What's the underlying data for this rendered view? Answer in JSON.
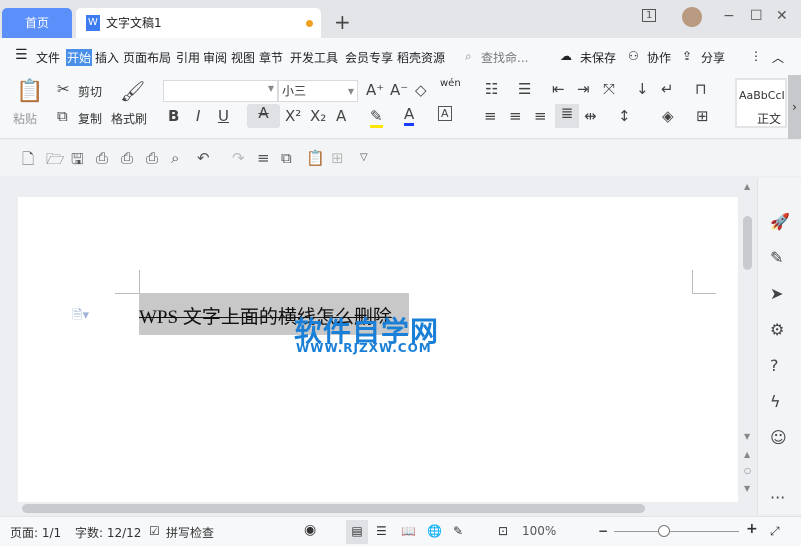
{
  "tabs": {
    "home": "首页",
    "doc_title": "文字文稿1",
    "new_tab": "+"
  },
  "window": {
    "page_count_icon": "1",
    "minimize": "−",
    "maximize": "☐",
    "close": "✕"
  },
  "menu": {
    "items": [
      "文件",
      "开始",
      "插入",
      "页面布局",
      "引用",
      "审阅",
      "视图",
      "章节",
      "开发工具",
      "会员专享",
      "稻壳资源"
    ],
    "search_placeholder": "查找命...",
    "unsaved": "未保存",
    "collab": "协作",
    "share": "分享"
  },
  "ribbon": {
    "paste": "粘贴",
    "cut": "剪切",
    "copy": "复制",
    "format_painter": "格式刷",
    "font_name": "",
    "font_size": "小三",
    "style_preview": "AaBbCcI",
    "style_name": "正文",
    "pinyin": "wén"
  },
  "document": {
    "text": "WPS 文字上面的横线怎么删除"
  },
  "watermark": {
    "title": "软件自学网",
    "url": "WWW.RJZXW.COM"
  },
  "status": {
    "page": "页面: 1/1",
    "words": "字数: 12/12",
    "spell": "拼写检查",
    "zoom": "100%"
  },
  "zoom_level": 100,
  "colors": {
    "accent": "#4a90e8",
    "highlight": "#ffe600",
    "font_color": "#1a3cff",
    "watermark": "#1a7fd6"
  }
}
